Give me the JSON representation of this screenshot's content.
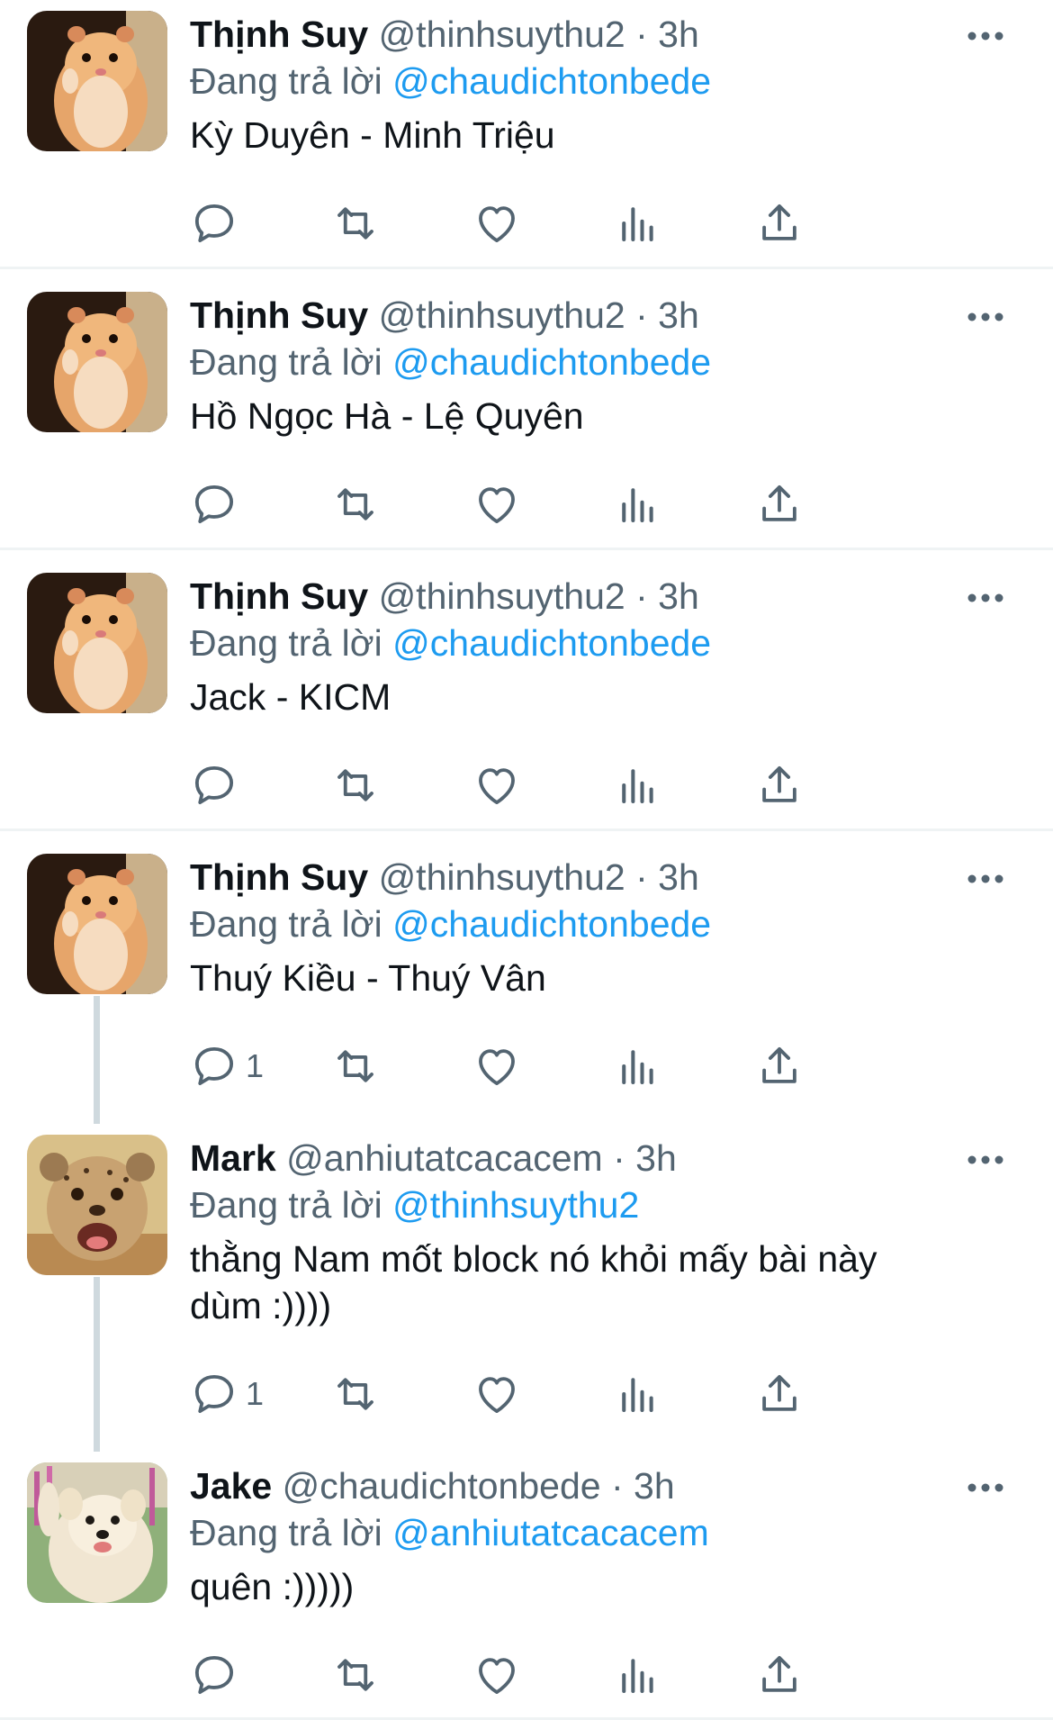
{
  "replying_label": "Đang trả lời",
  "colors": {
    "accent": "#1d9bf0",
    "secondary": "#536471",
    "divider": "#eff3f4"
  },
  "tweets": [
    {
      "name": "Thịnh Suy",
      "handle": "@thinhsuythu2",
      "time": "· 3h",
      "reply_to": "@chaudichtonbede",
      "text": "Kỳ Duyên - Minh Triệu",
      "reply_count": "",
      "avatar": "hamster-avatar"
    },
    {
      "name": "Thịnh Suy",
      "handle": "@thinhsuythu2",
      "time": "· 3h",
      "reply_to": "@chaudichtonbede",
      "text": "Hồ Ngọc Hà - Lệ Quyên",
      "reply_count": "",
      "avatar": "hamster-avatar"
    },
    {
      "name": "Thịnh Suy",
      "handle": "@thinhsuythu2",
      "time": "· 3h",
      "reply_to": "@chaudichtonbede",
      "text": "Jack - KICM",
      "reply_count": "",
      "avatar": "hamster-avatar"
    },
    {
      "name": "Thịnh Suy",
      "handle": "@thinhsuythu2",
      "time": "· 3h",
      "reply_to": "@chaudichtonbede",
      "text": "Thuý Kiều - Thuý Vân",
      "reply_count": "1",
      "avatar": "hamster-avatar"
    },
    {
      "name": "Mark",
      "handle": "@anhiutatcacacem",
      "time": "· 3h",
      "reply_to": "@thinhsuythu2",
      "text": "thằng Nam mốt block nó khỏi mấy bài này dùm :))))",
      "reply_count": "1",
      "avatar": "cheetah-cub-avatar"
    },
    {
      "name": "Jake",
      "handle": "@chaudichtonbede",
      "time": "· 3h",
      "reply_to": "@anhiutatcacacem",
      "text": "quên :)))))",
      "reply_count": "",
      "avatar": "samoyed-dog-avatar"
    }
  ]
}
